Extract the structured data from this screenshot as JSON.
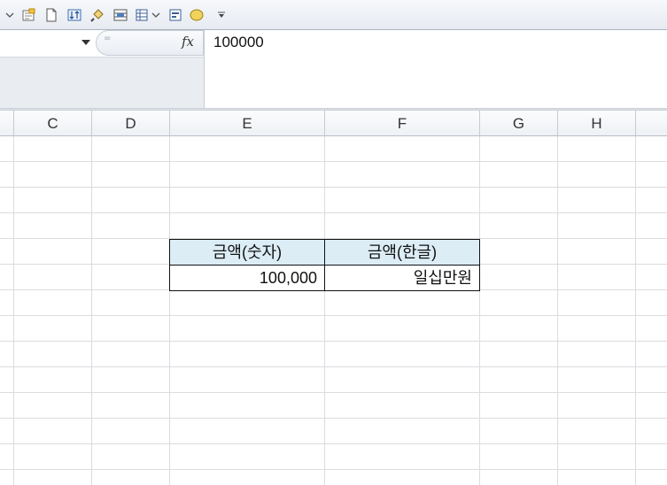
{
  "toolbar": {
    "icons": [
      "undo-dropdown-icon",
      "new-comment-icon",
      "new-document-icon",
      "sort-icon",
      "format-painter-icon",
      "merge-icon",
      "table-dropdown-icon",
      "form-icon",
      "shape-icon",
      "customize-dropdown-icon"
    ]
  },
  "formula_bar": {
    "name_box_value": "",
    "equals_label": "=",
    "fx_label": "fx",
    "formula_value": "100000"
  },
  "columns": [
    "C",
    "D",
    "E",
    "F",
    "G",
    "H"
  ],
  "table": {
    "header_amount_numeric": "금액(숫자)",
    "header_amount_korean": "금액(한글)",
    "value_numeric": "100,000",
    "value_korean": "일십만원"
  },
  "colors": {
    "header_fill": "#dcedf6",
    "grid_line": "#dadcdf",
    "column_header_bg": "#eef1f5"
  }
}
